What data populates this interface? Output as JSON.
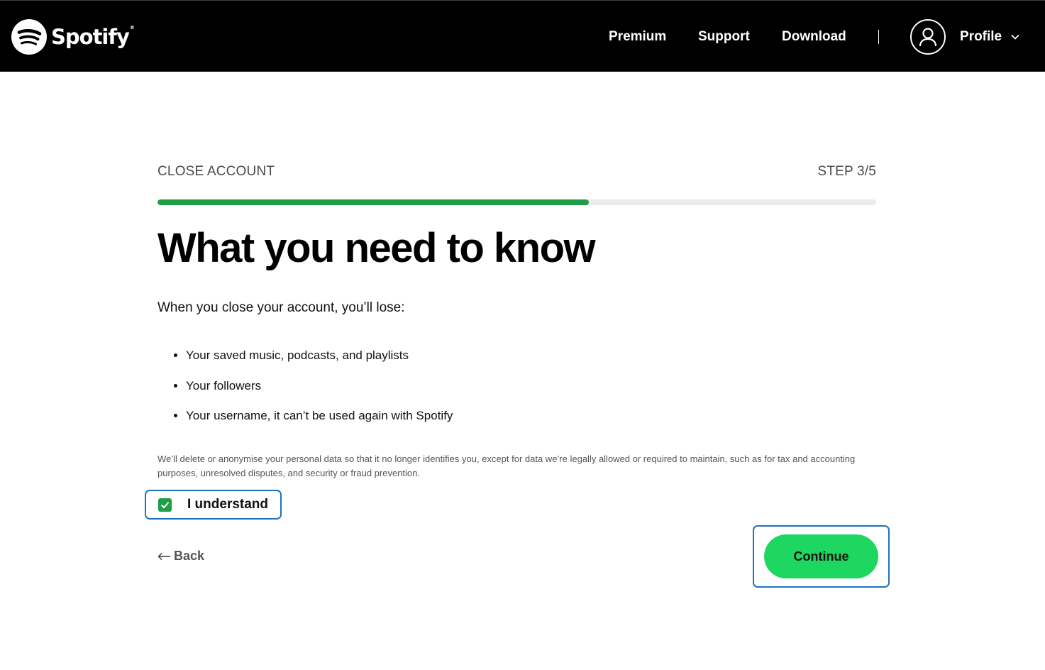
{
  "header": {
    "logo_text": "Spotify",
    "logo_reg": "®",
    "nav": {
      "premium": "Premium",
      "support": "Support",
      "download": "Download"
    },
    "profile_label": "Profile"
  },
  "step": {
    "title": "CLOSE ACCOUNT",
    "count": "STEP 3/5",
    "progress_fraction": 0.6
  },
  "main": {
    "heading": "What you need to know",
    "intro": "When you close your account, you’ll lose:",
    "losses": [
      "Your saved music, podcasts, and playlists",
      "Your followers",
      "Your username, it can’t be used again with Spotify"
    ],
    "legal": "We’ll delete or anonymise your personal data so that it no longer identifies you, except for data we’re legally allowed or required to maintain, such as for tax and accounting purposes, unresolved disputes, and security or fraud prevention.",
    "understand_label": "I understand",
    "understand_checked": true,
    "back_label": "Back",
    "continue_label": "Continue"
  },
  "colors": {
    "brand_green": "#1ed760",
    "progress_green": "#1e9e46",
    "focus_ring": "#1e73be"
  }
}
